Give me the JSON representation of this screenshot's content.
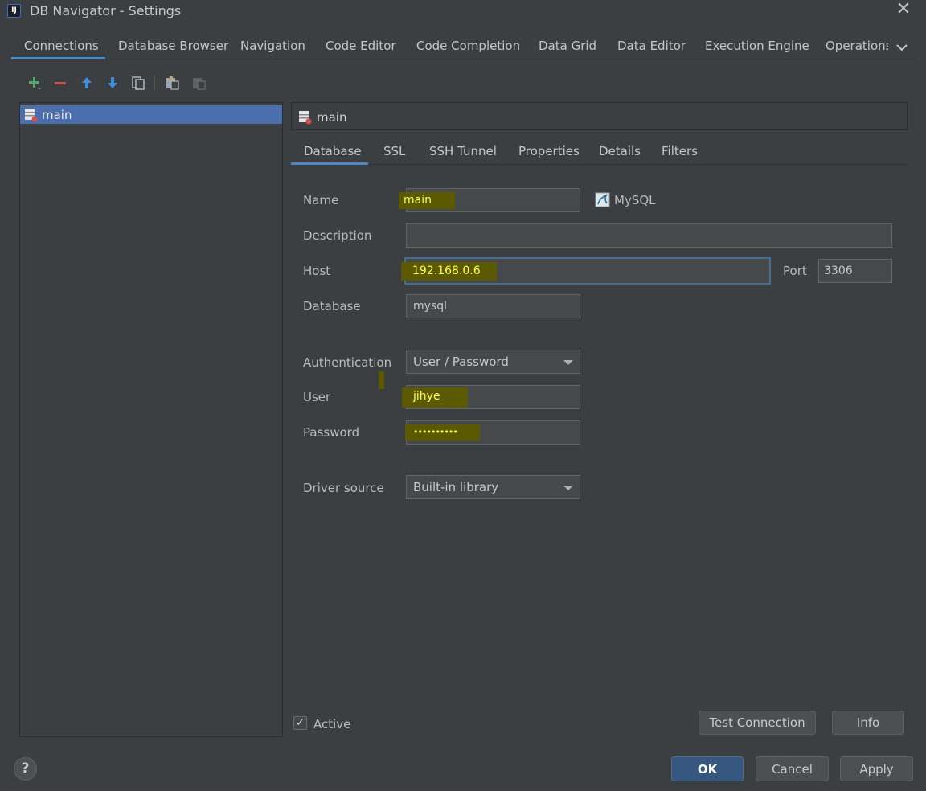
{
  "window": {
    "title": "DB Navigator - Settings",
    "app_icon_glyph": "IJ"
  },
  "settings_tabs": [
    "Connections",
    "Database Browser",
    "Navigation",
    "Code Editor",
    "Code Completion",
    "Data Grid",
    "Data Editor",
    "Execution Engine",
    "Operations"
  ],
  "toolbar": [
    "add-icon",
    "remove-icon",
    "move-up-icon",
    "move-down-icon",
    "copy-icon",
    "paste-icon",
    "paste-disabled-icon"
  ],
  "connections": [
    {
      "name": "main"
    }
  ],
  "selected_connection": {
    "name": "main"
  },
  "detail_tabs": [
    "Database",
    "SSL",
    "SSH Tunnel",
    "Properties",
    "Details",
    "Filters"
  ],
  "form": {
    "name_label": "Name",
    "name_value": "main",
    "db_type": "MySQL",
    "description_label": "Description",
    "description_value": "",
    "host_label": "Host",
    "host_value": "192.168.0.6",
    "port_label": "Port",
    "port_value": "3306",
    "database_label": "Database",
    "database_value": "mysql",
    "auth_label": "Authentication",
    "auth_value": "User / Password",
    "user_label": "User",
    "user_value": "jihye",
    "password_label": "Password",
    "password_value": "••••••••••",
    "driver_label": "Driver source",
    "driver_value": "Built-in library"
  },
  "active": {
    "label": "Active",
    "checked": true,
    "check_glyph": "✓"
  },
  "buttons": {
    "test_connection": "Test Connection",
    "info": "Info",
    "ok": "OK",
    "cancel": "Cancel",
    "apply": "Apply",
    "help": "?",
    "close": "✕"
  },
  "colors": {
    "accent": "#4a88c7",
    "selection": "#4b6eaf",
    "highlight": "#5b5a00",
    "highlight_text": "#ffff3f"
  }
}
